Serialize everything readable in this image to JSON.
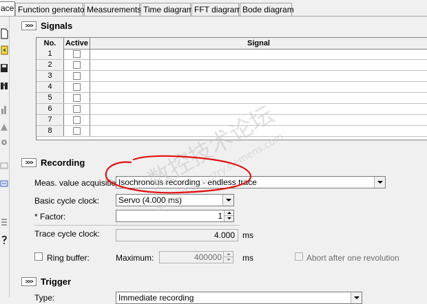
{
  "tabs": [
    {
      "label": "ace"
    },
    {
      "label": "Function generator"
    },
    {
      "label": "Measurements"
    },
    {
      "label": "Time diagram"
    },
    {
      "label": "FFT diagram"
    },
    {
      "label": "Bode diagram"
    }
  ],
  "toolbar_icons": [
    "new-file-icon",
    "reload-icon",
    "save-icon",
    "binoculars-icon",
    "chart-icon",
    "chart-icon",
    "gear-icon",
    "device-icon",
    "settings-icon",
    "list-icon",
    "help-icon"
  ],
  "signals": {
    "expand_label": ">>>",
    "title": "Signals",
    "columns": {
      "no": "No.",
      "active": "Active",
      "signal": "Signal"
    },
    "rows": [
      {
        "no": "1",
        "active": false,
        "signal": ""
      },
      {
        "no": "2",
        "active": false,
        "signal": ""
      },
      {
        "no": "3",
        "active": false,
        "signal": ""
      },
      {
        "no": "4",
        "active": false,
        "signal": ""
      },
      {
        "no": "5",
        "active": false,
        "signal": ""
      },
      {
        "no": "6",
        "active": false,
        "signal": ""
      },
      {
        "no": "7",
        "active": false,
        "signal": ""
      },
      {
        "no": "8",
        "active": false,
        "signal": ""
      }
    ]
  },
  "recording": {
    "expand_label": ">>>",
    "title": "Recording",
    "meas_label": "Meas. value acquisition:",
    "meas_value": "Isochronous recording - endless trace",
    "basic_label": "Basic cycle clock:",
    "basic_value": "Servo (4.000 ms)",
    "factor_label": "* Factor:",
    "factor_value": "1",
    "trace_label": "Trace cycle clock:",
    "trace_value": "4.000",
    "trace_unit": "ms",
    "ring_label": "Ring buffer:",
    "ring_checked": false,
    "max_label": "Maximum:",
    "max_value": "400000",
    "max_unit": "ms",
    "abort_label": "Abort after one revolution",
    "abort_checked": false
  },
  "trigger": {
    "expand_label": ">>>",
    "title": "Trigger",
    "type_label": "Type:",
    "type_value": "Immediate recording"
  },
  "watermark": {
    "line1": "数控技术论坛",
    "line2": "support.industry.siemens.com"
  },
  "colors": {
    "annotation": "#e01010",
    "panel_bg": "#f0f0f0"
  }
}
